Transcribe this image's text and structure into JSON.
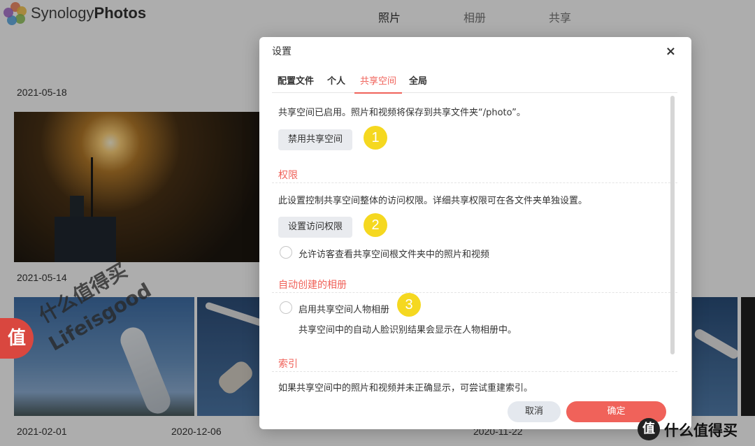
{
  "app": {
    "brand_light": "Synology",
    "brand_bold": "Photos",
    "nav": [
      "照片",
      "相册",
      "共享"
    ]
  },
  "dates": {
    "d1": "2021-05-18",
    "d2": "2021-05-14",
    "d3": "2021-02-01",
    "d4": "2020-12-06",
    "d5": "2020-11-22"
  },
  "watermark": {
    "badge_char": "值",
    "line1": "什么值得买",
    "line2": "Lifeisgood",
    "corner_icon": "值",
    "corner_text": "什么值得买"
  },
  "dialog": {
    "title": "设置",
    "close": "×",
    "tabs": [
      "配置文件",
      "个人",
      "共享空间",
      "全局"
    ],
    "active_tab": "共享空间",
    "shared_status": "共享空间已启用。照片和视频将保存到共享文件夹“/photo”。",
    "disable_button": "禁用共享空间",
    "permissions": {
      "title": "权限",
      "desc": "此设置控制共享空间整体的访问权限。详细共享权限可在各文件夹单独设置。",
      "button": "设置访问权限",
      "guest_option": "允许访客查看共享空间根文件夹中的照片和视频"
    },
    "auto_albums": {
      "title": "自动创建的相册",
      "option": "启用共享空间人物相册",
      "hint": "共享空间中的自动人脸识别结果会显示在人物相册中。"
    },
    "index": {
      "title": "索引",
      "desc": "如果共享空间中的照片和视频并未正确显示，可尝试重建索引。"
    },
    "cancel": "取消",
    "ok": "确定"
  },
  "markers": [
    "1",
    "2",
    "3"
  ],
  "colors": {
    "accent": "#f0625a",
    "marker": "#f5d820"
  }
}
